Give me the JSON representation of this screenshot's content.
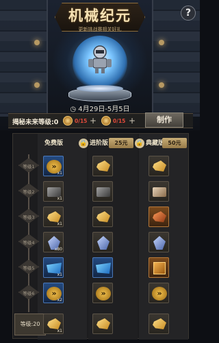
{
  "header": {
    "title": "机械纪元",
    "subtitle": "更新挑战赛相关好礼",
    "help_label": "?"
  },
  "event": {
    "date_range": "◷ 4月29日-5月5日"
  },
  "cost_bar": {
    "level_label": "揭秘未来等级:0",
    "token1_count": "0/15",
    "token2_count": "0/15",
    "plus": "+",
    "make_button": "制作"
  },
  "tracks": {
    "free_label": "免费版",
    "advanced_label": "进阶版",
    "advanced_price": "25元",
    "collector_label": "典藏版",
    "collector_price": "50元"
  },
  "levels": [
    {
      "label": "等级1"
    },
    {
      "label": "等级2"
    },
    {
      "label": "等级3"
    },
    {
      "label": "等级4"
    },
    {
      "label": "等级5"
    },
    {
      "label": "等级6"
    },
    {
      "label": "等级:20"
    }
  ],
  "rewards": [
    {
      "free": {
        "icon": "chevron-token-icon",
        "qty": "x1"
      },
      "adv": {
        "icon": "gold-ore-icon",
        "qty": ""
      },
      "col": {
        "icon": "gold-ore-icon",
        "qty": ""
      }
    },
    {
      "free": {
        "icon": "iron-block-icon",
        "qty": "x1"
      },
      "adv": {
        "icon": "iron-block-icon",
        "qty": ""
      },
      "col": {
        "icon": "envelope-icon",
        "qty": ""
      }
    },
    {
      "free": {
        "icon": "gold-ore-icon",
        "qty": "x1"
      },
      "adv": {
        "icon": "gold-ore-icon",
        "qty": ""
      },
      "col": {
        "icon": "copper-ore-icon",
        "qty": ""
      }
    },
    {
      "free": {
        "icon": "crystal-icon",
        "qty": "x80"
      },
      "adv": {
        "icon": "crystal-icon",
        "qty": ""
      },
      "col": {
        "icon": "crystal-icon",
        "qty": ""
      }
    },
    {
      "free": {
        "icon": "blue-shard-icon",
        "qty": "x1"
      },
      "adv": {
        "icon": "blue-shard-icon",
        "qty": ""
      },
      "col": {
        "icon": "supply-box-icon",
        "qty": ""
      }
    },
    {
      "free": {
        "icon": "chevron-token-icon",
        "qty": "x2"
      },
      "adv": {
        "icon": "chevron-token-icon",
        "qty": ""
      },
      "col": {
        "icon": "chevron-token-icon",
        "qty": ""
      }
    },
    {
      "free": {
        "icon": "gold-ore-icon",
        "qty": "x1"
      },
      "adv": {
        "icon": "gold-ore-icon",
        "qty": ""
      },
      "col": {
        "icon": "gold-ore-icon",
        "qty": ""
      }
    }
  ]
}
